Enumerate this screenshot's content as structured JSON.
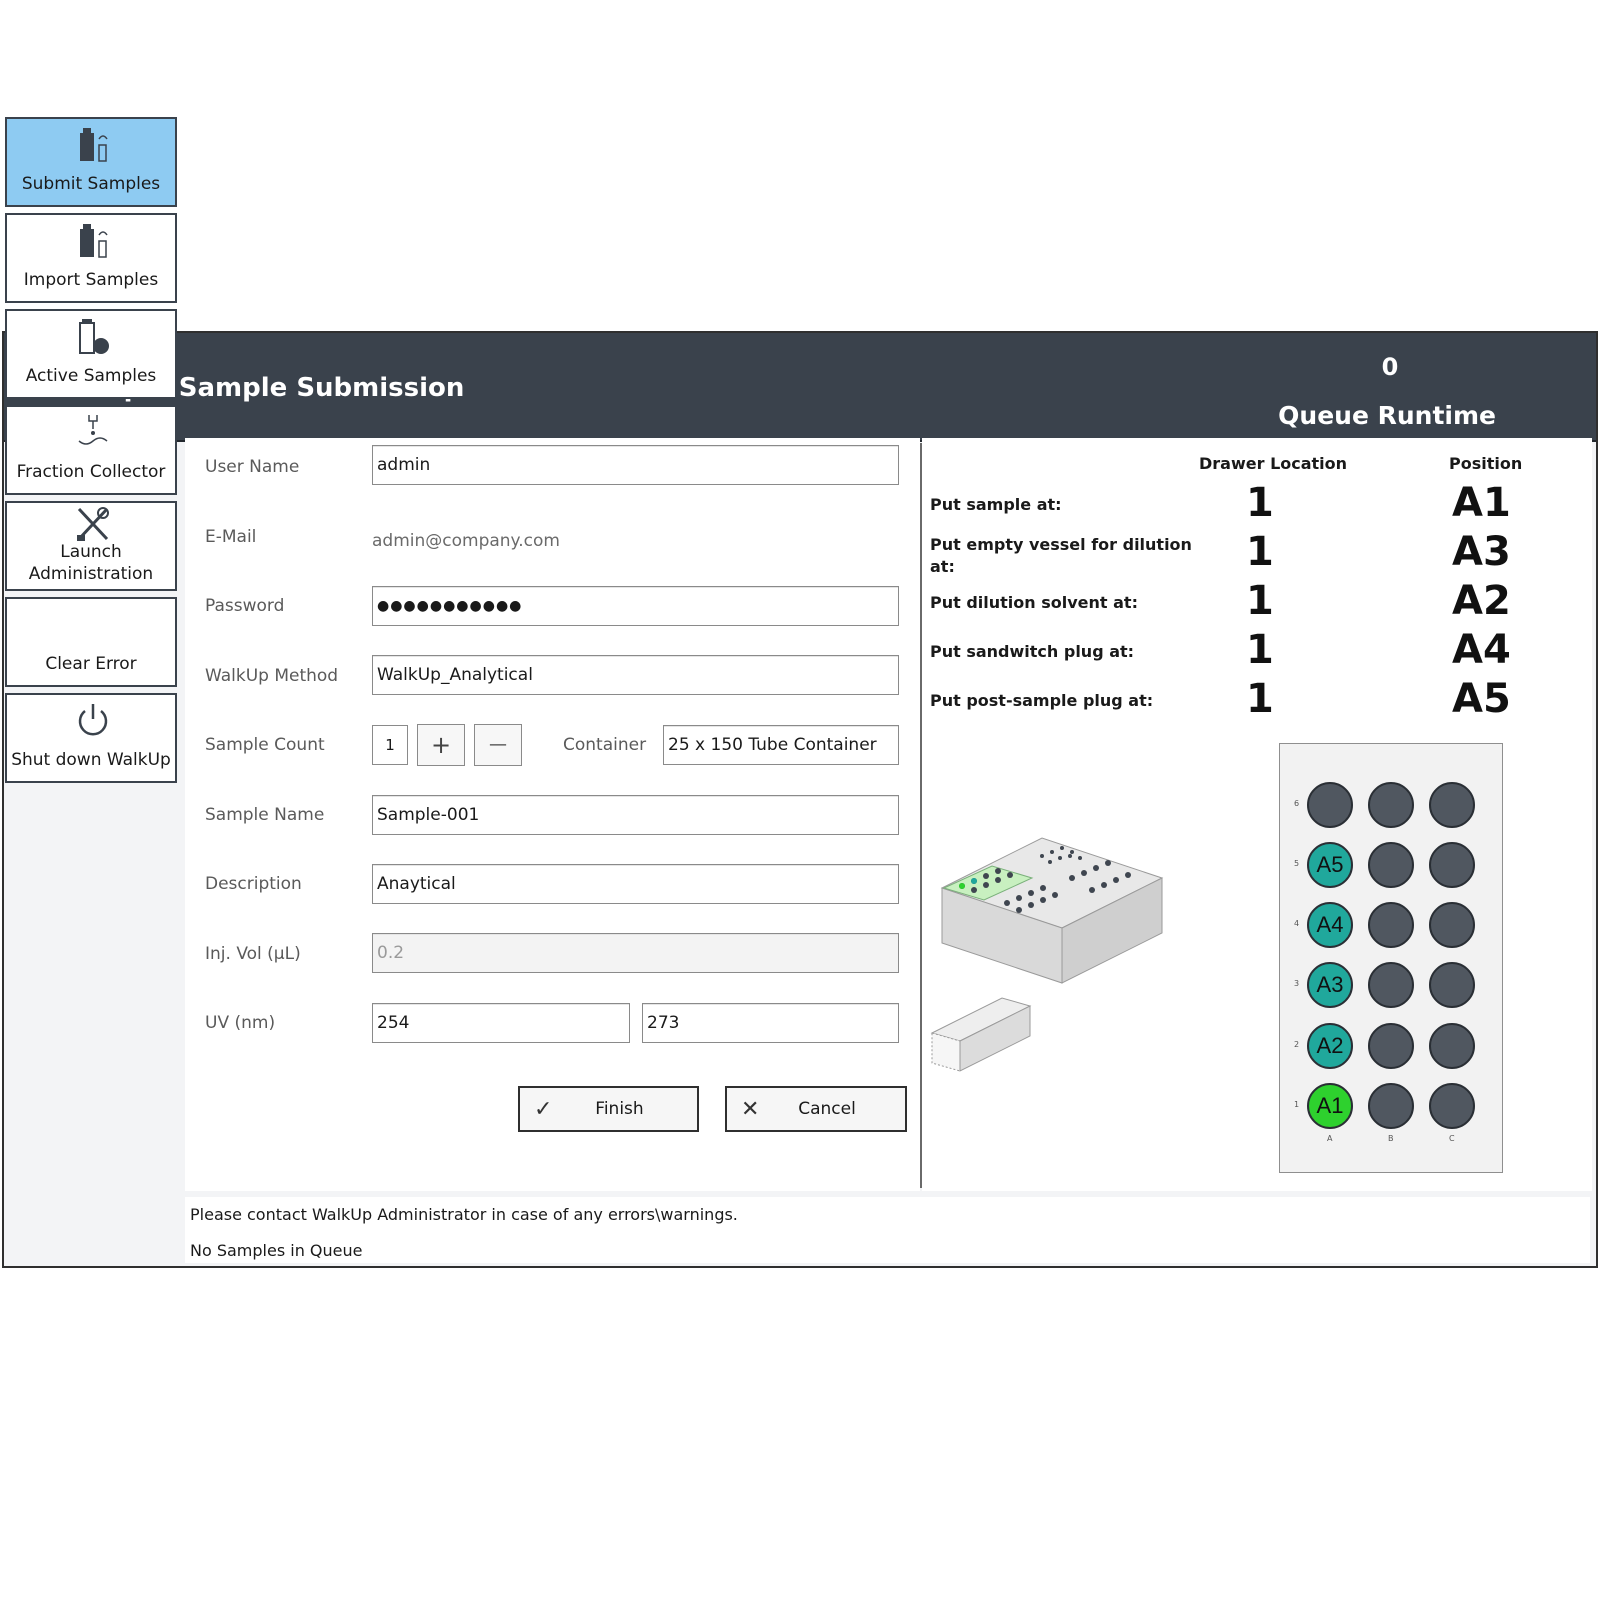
{
  "header": {
    "title": "Rapid Sample Submission",
    "queue_count": "0",
    "queue_label": "Queue Runtime"
  },
  "sidebar": {
    "items": [
      {
        "label": "Submit Samples",
        "icon": "submit-samples-icon",
        "active": true
      },
      {
        "label": "Import Samples",
        "icon": "import-samples-icon"
      },
      {
        "label": "Active Samples",
        "icon": "active-samples-icon"
      },
      {
        "label": "Fraction Collector",
        "icon": "fraction-collector-icon"
      },
      {
        "label": "Launch",
        "label2": "Administration",
        "icon": "tools-icon"
      },
      {
        "label": "Clear Error"
      },
      {
        "label": "Shut down WalkUp",
        "icon": "power-icon"
      }
    ]
  },
  "form": {
    "user_name_label": "User Name",
    "user_name": "admin",
    "email_label": "E-Mail",
    "email": "admin@company.com",
    "password_label": "Password",
    "password": "●●●●●●●●●●●",
    "method_label": "WalkUp Method",
    "method": "WalkUp_Analytical",
    "sample_count_label": "Sample Count",
    "sample_count": "1",
    "plus": "+",
    "minus": "—",
    "container_label": "Container",
    "container": "25 x 150 Tube Container",
    "sample_name_label": "Sample Name",
    "sample_name": "Sample-001",
    "description_label": "Description",
    "description": "Anaytical",
    "inj_vol_label": "Inj. Vol (µL)",
    "inj_vol": "0.2",
    "uv_label": "UV (nm)",
    "uv1": "254",
    "uv2": "273",
    "finish_label": "Finish",
    "cancel_label": "Cancel"
  },
  "placement": {
    "drawer_header": "Drawer Location",
    "position_header": "Position",
    "rows": [
      {
        "label": "Put sample at:",
        "drawer": "1",
        "position": "A1"
      },
      {
        "label": "Put empty vessel for dilution",
        "label2": "at:",
        "drawer": "1",
        "position": "A3"
      },
      {
        "label": "Put dilution solvent at:",
        "drawer": "1",
        "position": "A2"
      },
      {
        "label": "Put sandwitch plug at:",
        "drawer": "1",
        "position": "A4"
      },
      {
        "label": "Put post-sample plug at:",
        "drawer": "1",
        "position": "A5"
      }
    ]
  },
  "rack": {
    "row_numbers": [
      "6",
      "5",
      "4",
      "3",
      "2",
      "1"
    ],
    "col_letters": [
      "A",
      "B",
      "C"
    ],
    "labeled": {
      "A1": "A1",
      "A2": "A2",
      "A3": "A3",
      "A4": "A4",
      "A5": "A5"
    },
    "colors": {
      "empty": "#505760",
      "assigned": "#20a89c",
      "sample": "#2ed12e"
    }
  },
  "status": {
    "message": "Please contact WalkUp Administrator in case of any errors\\warnings.",
    "queue": "No Samples in Queue"
  }
}
